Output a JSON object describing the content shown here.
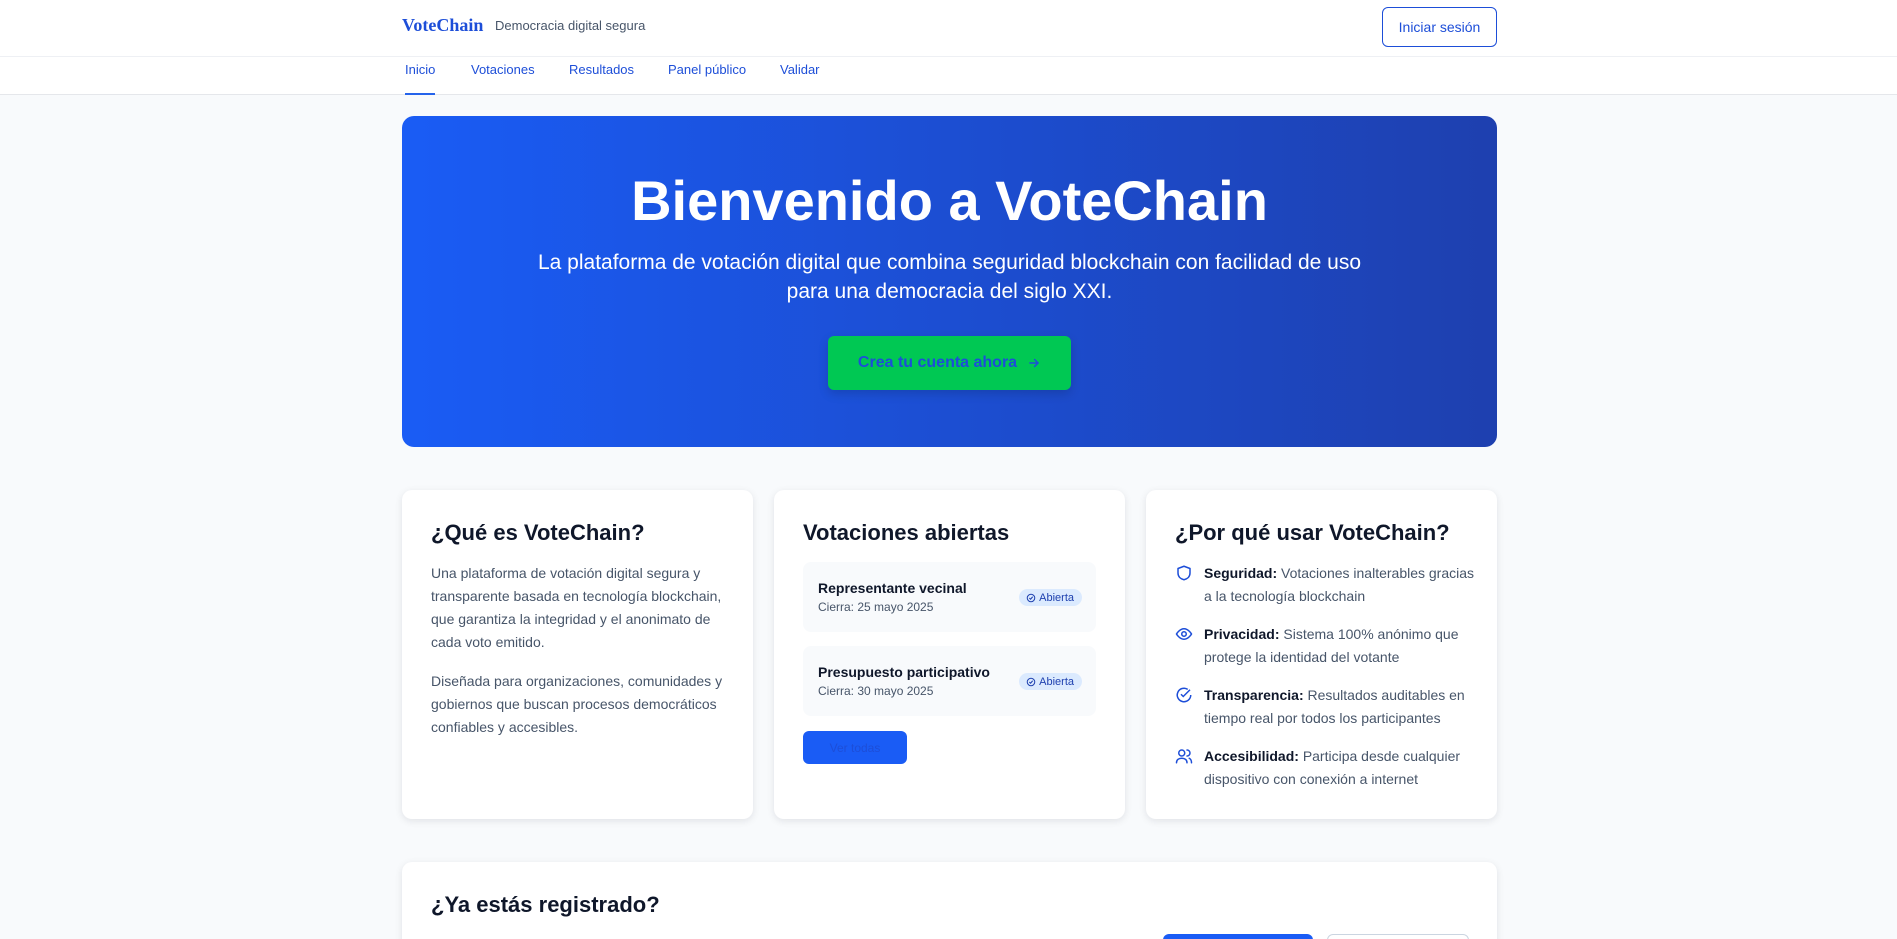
{
  "header": {
    "brand": "VoteChain",
    "tagline": "Democracia digital segura",
    "login_label": "Iniciar sesión"
  },
  "nav": {
    "items": [
      {
        "label": "Inicio",
        "active": true
      },
      {
        "label": "Votaciones"
      },
      {
        "label": "Resultados"
      },
      {
        "label": "Panel público"
      },
      {
        "label": "Validar"
      }
    ]
  },
  "hero": {
    "title": "Bienvenido a VoteChain",
    "subtitle": "La plataforma de votación digital que combina seguridad blockchain con facilidad de uso para una democracia del siglo XXI.",
    "cta_label": "Crea tu cuenta ahora",
    "cta_icon": "arrow-right-icon"
  },
  "about": {
    "title": "¿Qué es VoteChain?",
    "p1": "Una plataforma de votación digital segura y transparente basada en tecnología blockchain, que garantiza la integridad y el anonimato de cada voto emitido.",
    "p2": "Diseñada para organizaciones, comunidades y gobiernos que buscan procesos democráticos confiables y accesibles."
  },
  "open_votes": {
    "title": "Votaciones abiertas",
    "items": [
      {
        "title": "Representante vecinal",
        "date": "Cierra: 25 mayo 2025",
        "status": "Abierta"
      },
      {
        "title": "Presupuesto participativo",
        "date": "Cierra: 30 mayo 2025",
        "status": "Abierta"
      }
    ],
    "more_label": "Ver todas"
  },
  "why": {
    "title": "¿Por qué usar VoteChain?",
    "features": [
      {
        "icon": "shield-icon",
        "title": "Seguridad:",
        "text": "Votaciones inalterables gracias a la tecnología blockchain"
      },
      {
        "icon": "eye-icon",
        "title": "Privacidad:",
        "text": "Sistema 100% anónimo que protege la identidad del votante"
      },
      {
        "icon": "check-circle-icon",
        "title": "Transparencia:",
        "text": "Resultados auditables en tiempo real por todos los participantes"
      },
      {
        "icon": "users-icon",
        "title": "Accesibilidad:",
        "text": "Participa desde cualquier dispositivo con conexión a internet"
      }
    ]
  },
  "registered": {
    "title": "¿Ya estás registrado?"
  },
  "colors": {
    "brand": "#1d4ed8",
    "hero_start": "#1a5cf5",
    "hero_end": "#1e40af",
    "cta": "#00c853",
    "badge_bg": "#dbeafe"
  }
}
